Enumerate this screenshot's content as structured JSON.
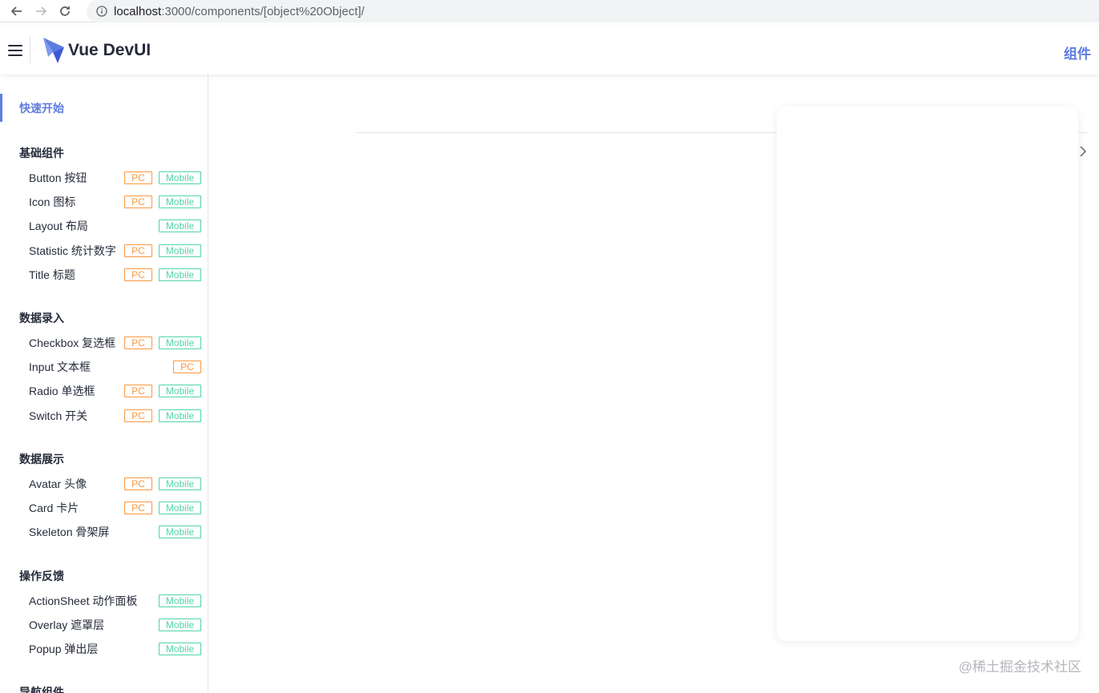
{
  "browser": {
    "url_host": "localhost",
    "url_path": ":3000/components/[object%20Object]/"
  },
  "header": {
    "logo_text": "Vue DevUI",
    "nav_link": "组件"
  },
  "sidebar": {
    "quick_start": "快速开始",
    "groups": [
      {
        "title": "基础组件",
        "items": [
          {
            "name": "Button 按钮",
            "pc": "PC",
            "mobile": "Mobile"
          },
          {
            "name": "Icon 图标",
            "pc": "PC",
            "mobile": "Mobile"
          },
          {
            "name": "Layout 布局",
            "mobile": "Mobile"
          },
          {
            "name": "Statistic 统计数字",
            "pc": "PC",
            "mobile": "Mobile"
          },
          {
            "name": "Title 标题",
            "pc": "PC",
            "mobile": "Mobile"
          }
        ]
      },
      {
        "title": "数据录入",
        "items": [
          {
            "name": "Checkbox 复选框",
            "pc": "PC",
            "mobile": "Mobile"
          },
          {
            "name": "Input 文本框",
            "pc": "PC"
          },
          {
            "name": "Radio 单选框",
            "pc": "PC",
            "mobile": "Mobile"
          },
          {
            "name": "Switch 开关",
            "pc": "PC",
            "mobile": "Mobile"
          }
        ]
      },
      {
        "title": "数据展示",
        "items": [
          {
            "name": "Avatar 头像",
            "pc": "PC",
            "mobile": "Mobile"
          },
          {
            "name": "Card 卡片",
            "pc": "PC",
            "mobile": "Mobile"
          },
          {
            "name": "Skeleton 骨架屏",
            "mobile": "Mobile"
          }
        ]
      },
      {
        "title": "操作反馈",
        "items": [
          {
            "name": "ActionSheet 动作面板",
            "mobile": "Mobile"
          },
          {
            "name": "Overlay 遮罩层",
            "mobile": "Mobile"
          },
          {
            "name": "Popup 弹出层",
            "mobile": "Mobile"
          }
        ]
      },
      {
        "title": "导航组件",
        "items": []
      }
    ]
  },
  "watermark": "@稀土掘金技术社区",
  "colors": {
    "primary": "#5e7ce0",
    "pc_tag": "#fa9841",
    "mobile_tag": "#50d4ab",
    "text": "#252b3a"
  }
}
